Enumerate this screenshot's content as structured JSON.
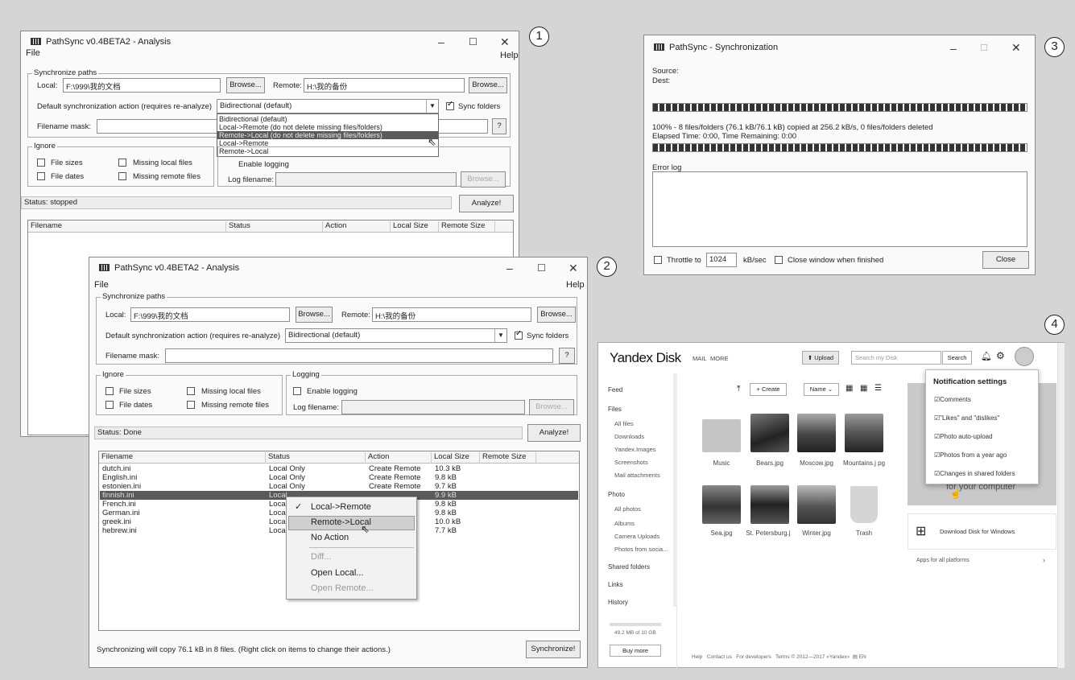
{
  "labels": {
    "w1": "1",
    "w2": "2",
    "w3": "3",
    "w4": "4"
  },
  "w1": {
    "title": "PathSync v0.4BETA2 - Analysis",
    "menu_file": "File",
    "menu_help": "Help",
    "sync_group": "Synchronize paths",
    "local_label": "Local:",
    "local_value": "F:\\999\\我的文档",
    "browse": "Browse...",
    "remote_label": "Remote:",
    "remote_value": "H:\\我的备份",
    "action_label": "Default synchronization action (requires re-analyze)",
    "action_value": "Bidirectional (default)",
    "sync_folders": "Sync folders",
    "mask_label": "Filename mask:",
    "mask_help": "?",
    "dropdown_options": [
      "Bidirectional (default)",
      "Local->Remote (do not delete missing files/folders)",
      "Remote->Local (do not delete missing files/folders)",
      "Local->Remote",
      "Remote->Local"
    ],
    "ignore_group": "Ignore",
    "file_sizes": "File sizes",
    "file_dates": "File dates",
    "missing_local": "Missing local files",
    "missing_remote": "Missing remote files",
    "enable_logging": "Enable logging",
    "log_filename": "Log filename:",
    "status": "Status: stopped",
    "analyze": "Analyze!",
    "columns": [
      "Filename",
      "Status",
      "Action",
      "Local Size",
      "Remote Size"
    ]
  },
  "w2": {
    "title": "PathSync v0.4BETA2 - Analysis",
    "menu_file": "File",
    "menu_help": "Help",
    "sync_group": "Synchronize paths",
    "local_label": "Local:",
    "local_value": "F:\\999\\我的文档",
    "browse": "Browse...",
    "remote_label": "Remote:",
    "remote_value": "H:\\我的备份",
    "action_label": "Default synchronization action (requires re-analyze)",
    "action_value": "Bidirectional (default)",
    "sync_folders": "Sync folders",
    "mask_label": "Filename mask:",
    "mask_help": "?",
    "ignore_group": "Ignore",
    "logging_group": "Logging",
    "file_sizes": "File sizes",
    "file_dates": "File dates",
    "missing_local": "Missing local files",
    "missing_remote": "Missing remote files",
    "enable_logging": "Enable logging",
    "log_filename": "Log filename:",
    "status": "Status: Done",
    "analyze": "Analyze!",
    "columns": [
      "Filename",
      "Status",
      "Action",
      "Local Size",
      "Remote Size"
    ],
    "rows": [
      {
        "name": "dutch.ini",
        "status": "Local Only",
        "action": "Create Remote",
        "size": "10.3 kB"
      },
      {
        "name": "English.ini",
        "status": "Local Only",
        "action": "Create Remote",
        "size": "9.8 kB"
      },
      {
        "name": "estonien.ini",
        "status": "Local Only",
        "action": "Create Remote",
        "size": "9.7 kB"
      },
      {
        "name": "finnish.ini",
        "status": "Local",
        "action": "",
        "size": "9.9 kB"
      },
      {
        "name": "French.ini",
        "status": "Loca",
        "action": "e",
        "size": "9.8 kB"
      },
      {
        "name": "German.ini",
        "status": "Loca",
        "action": "e",
        "size": "9.8 kB"
      },
      {
        "name": "greek.ini",
        "status": "Loca",
        "action": "e",
        "size": "10.0 kB"
      },
      {
        "name": "hebrew.ini",
        "status": "Loca",
        "action": "e",
        "size": "7.7 kB"
      }
    ],
    "context_menu": {
      "item1": "Local->Remote",
      "item2": "Remote->Local",
      "item3": "No Action",
      "item4": "Diff...",
      "item5": "Open Local...",
      "item6": "Open Remote..."
    },
    "footer": "Synchronizing will copy 76.1 kB in 8 files. (Right click on items to change their actions.)",
    "synchronize": "Synchronize!"
  },
  "w3": {
    "title": "PathSync - Synchronization",
    "source": "Source:",
    "dest": "Dest:",
    "progress_text": "100% - 8 files/folders (76.1 kB/76.1 kB) copied at 256.2 kB/s, 0 files/folders deleted",
    "elapsed": "Elapsed Time: 0:00, Time Remaining: 0:00",
    "progress1": 1.0,
    "progress2": 1.0,
    "error_log": "Error log",
    "throttle": "Throttle to",
    "throttle_value": "1024",
    "kbsec": "kB/sec",
    "close_when": "Close window when finished",
    "close": "Close"
  },
  "w4": {
    "logo": "Yandex Disk",
    "mail": "MAIL",
    "more": "MORE",
    "upload": "Upload",
    "search_placeholder": "Search my Disk",
    "search": "Search",
    "nav": {
      "feed": "Feed",
      "files": "Files",
      "all_files": "All files",
      "downloads": "Downloads",
      "yandex_images": "Yandex.Images",
      "screenshots": "Screenshots",
      "mail_attachments": "Mail attachments",
      "photo": "Photo",
      "all_photos": "All photos",
      "albums": "Albums",
      "camera_uploads": "Camera Uploads",
      "photos_social": "Photos from socia...",
      "shared": "Shared folders",
      "links": "Links",
      "history": "History"
    },
    "storage": "49.2 MB of 10 GB",
    "buy_more": "Buy more",
    "create": "Create",
    "sort": "Name",
    "files": [
      {
        "name": "Music"
      },
      {
        "name": "Bears.jpg"
      },
      {
        "name": "Moscow.jpg"
      },
      {
        "name": "Mountains.j pg"
      },
      {
        "name": "Sea.jpg"
      },
      {
        "name": "St. Petersburg.j"
      },
      {
        "name": "Winter.jpg"
      },
      {
        "name": "Trash"
      }
    ],
    "notif_title": "Notification settings",
    "notif_items": [
      "Comments",
      "\"Likes\" and \"dislikes\"",
      "Photo auto-upload",
      "Photos from a year ago",
      "Changes in shared folders"
    ],
    "promo_text": "for your computer",
    "download_windows": "Download Disk for Windows",
    "apps_all": "Apps for all platforms",
    "footer": {
      "help": "Help",
      "contact": "Contact us",
      "dev": "For developers",
      "terms": "Terms",
      "copyright": "© 2012—2017 «Yandex»",
      "lang": "EN"
    }
  }
}
